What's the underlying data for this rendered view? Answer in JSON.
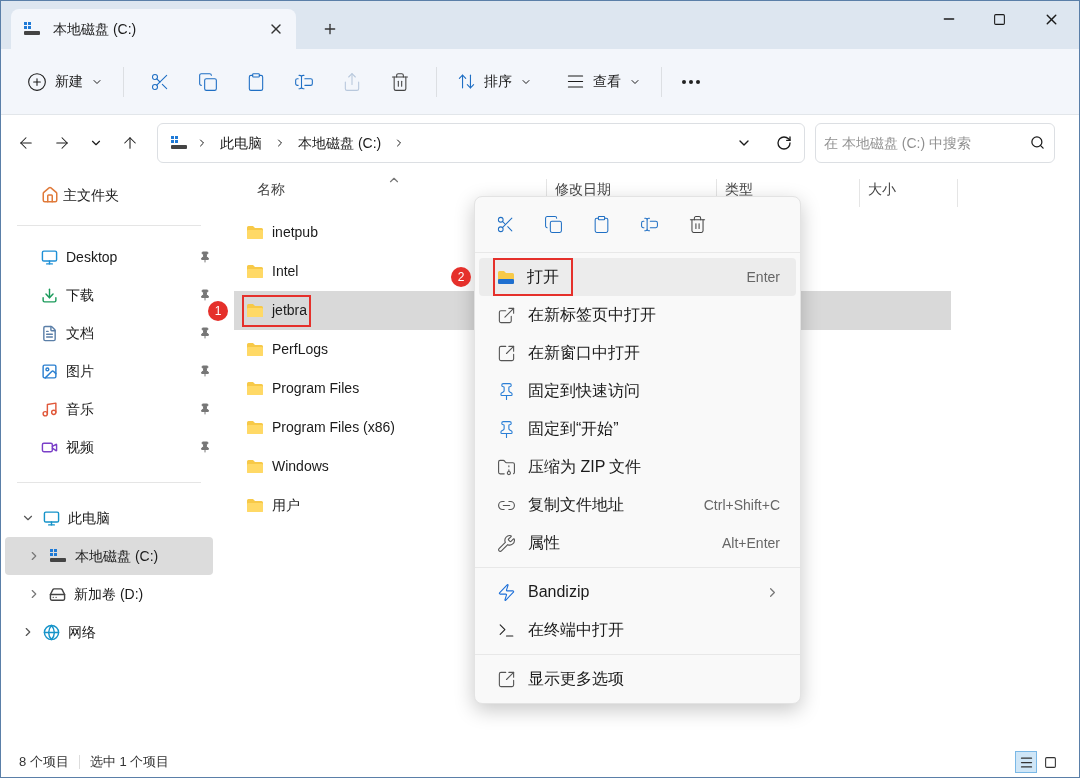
{
  "tabs": [
    {
      "title": "本地磁盘 (C:)",
      "selected": true
    }
  ],
  "toolbar": {
    "new_label": "新建",
    "icon_buttons": [
      {
        "kind": "cut",
        "disabled": false
      },
      {
        "kind": "copy",
        "disabled": false
      },
      {
        "kind": "paste",
        "disabled": false
      },
      {
        "kind": "rename",
        "disabled": false
      },
      {
        "kind": "share",
        "disabled": true
      },
      {
        "kind": "delete",
        "disabled": false
      }
    ],
    "sort_label": "排序",
    "view_label": "查看"
  },
  "address": {
    "crumbs": [
      "此电脑",
      "本地磁盘 (C:)"
    ]
  },
  "search": {
    "placeholder": "在 本地磁盘 (C:) 中搜索"
  },
  "sidebar": {
    "home": "主文件夹",
    "quick_access": [
      {
        "label": "Desktop",
        "kind": "desktop",
        "pinned": true
      },
      {
        "label": "下载",
        "kind": "downloads",
        "pinned": true
      },
      {
        "label": "文档",
        "kind": "documents",
        "pinned": true
      },
      {
        "label": "图片",
        "kind": "pictures",
        "pinned": true
      },
      {
        "label": "音乐",
        "kind": "music",
        "pinned": true
      },
      {
        "label": "视频",
        "kind": "videos",
        "pinned": true
      }
    ],
    "tree": [
      {
        "label": "此电脑",
        "kind": "pc",
        "expanded": true,
        "selected": false,
        "children": [
          {
            "label": "本地磁盘 (C:)",
            "kind": "system_drive",
            "expanded": false,
            "selected": true
          },
          {
            "label": "新加卷 (D:)",
            "kind": "drive",
            "expanded": false,
            "selected": false
          }
        ]
      },
      {
        "label": "网络",
        "kind": "network",
        "expanded": false,
        "selected": false
      }
    ]
  },
  "columns": [
    {
      "label": "名称",
      "sorted": true
    },
    {
      "label": "修改日期"
    },
    {
      "label": "类型"
    },
    {
      "label": "大小"
    }
  ],
  "files": [
    {
      "name": "inetpub",
      "selected": false
    },
    {
      "name": "Intel",
      "selected": false
    },
    {
      "name": "jetbra",
      "selected": true,
      "annotation": "1"
    },
    {
      "name": "PerfLogs",
      "selected": false
    },
    {
      "name": "Program Files",
      "selected": false
    },
    {
      "name": "Program Files (x86)",
      "selected": false
    },
    {
      "name": "Windows",
      "selected": false
    },
    {
      "name": "用户",
      "selected": false
    }
  ],
  "context_menu": {
    "quick_actions": [
      {
        "kind": "cut"
      },
      {
        "kind": "copy"
      },
      {
        "kind": "paste"
      },
      {
        "kind": "rename"
      },
      {
        "kind": "delete"
      }
    ],
    "sections": [
      [
        {
          "kind": "open",
          "label": "打开",
          "shortcut": "Enter",
          "highlighted": true,
          "annotation": "2"
        },
        {
          "kind": "open_tab",
          "label": "在新标签页中打开",
          "highlighted": false
        },
        {
          "kind": "open_window",
          "label": "在新窗口中打开",
          "highlighted": false
        },
        {
          "kind": "pin",
          "label": "固定到快速访问",
          "highlighted": false
        },
        {
          "kind": "pin",
          "label": "固定到“开始”",
          "highlighted": false
        },
        {
          "kind": "zip",
          "label": "压缩为 ZIP 文件",
          "highlighted": false
        },
        {
          "kind": "copy_path",
          "label": "复制文件地址",
          "shortcut": "Ctrl+Shift+C",
          "highlighted": false
        },
        {
          "kind": "properties",
          "label": "属性",
          "shortcut": "Alt+Enter",
          "highlighted": false
        }
      ],
      [
        {
          "kind": "bandizip",
          "label": "Bandizip",
          "submenu": true,
          "highlighted": false
        },
        {
          "kind": "terminal",
          "label": "在终端中打开",
          "highlighted": false
        }
      ],
      [
        {
          "kind": "more",
          "label": "显示更多选项",
          "highlighted": false
        }
      ]
    ]
  },
  "status_bar": {
    "texts": [
      "8 个项目",
      "选中 1 个项目"
    ],
    "views": [
      {
        "kind": "details",
        "selected": true
      },
      {
        "kind": "tiles",
        "selected": false
      }
    ]
  }
}
